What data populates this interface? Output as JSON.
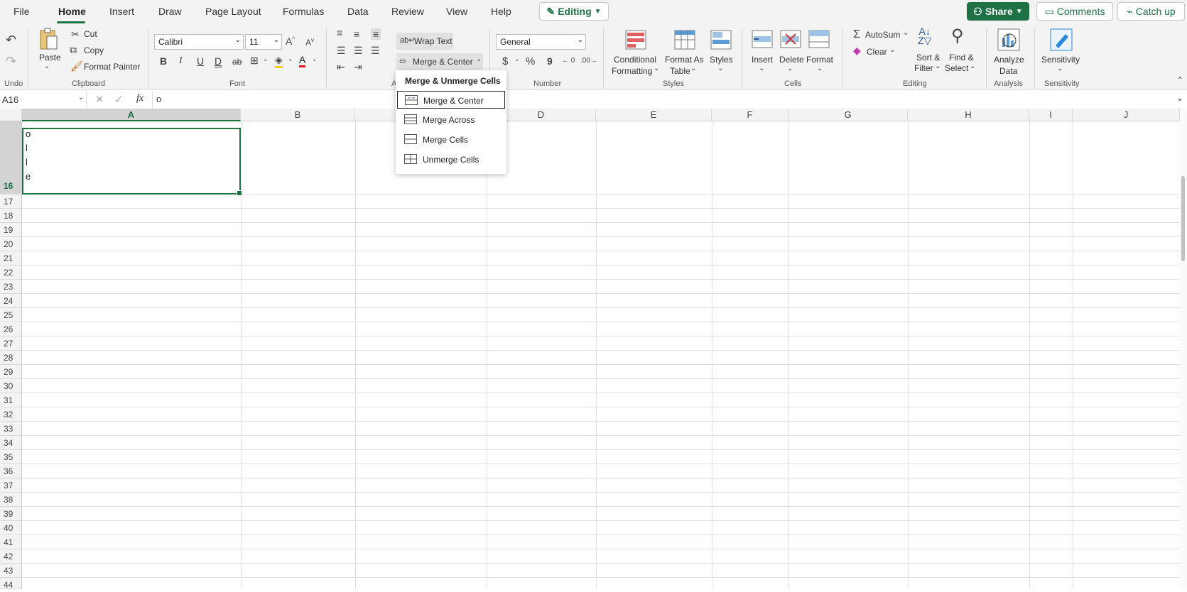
{
  "tabs": [
    "File",
    "Home",
    "Insert",
    "Draw",
    "Page Layout",
    "Formulas",
    "Data",
    "Review",
    "View",
    "Help"
  ],
  "editing_label": "Editing",
  "share_label": "Share",
  "comments_label": "Comments",
  "catchup_label": "Catch up",
  "ribbon": {
    "undo_group": "Undo",
    "clipboard": {
      "paste": "Paste",
      "cut": "Cut",
      "copy": "Copy",
      "format_painter": "Format Painter",
      "group": "Clipboard"
    },
    "font": {
      "name": "Calibri",
      "size": "11",
      "group": "Font",
      "bold": "B",
      "italic": "I",
      "underline": "U",
      "double_underline": "D",
      "strike": "ab"
    },
    "alignment": {
      "wrap_text": "Wrap Text",
      "merge_center": "Merge & Center",
      "group_fragment": "A"
    },
    "number": {
      "format": "General",
      "currency": "$",
      "percent": "%",
      "comma": "9",
      "group": "Number"
    },
    "styles": {
      "conditional": "Conditional",
      "conditional2": "Formatting",
      "format_as": "Format As",
      "format_as2": "Table",
      "styles": "Styles",
      "group": "Styles"
    },
    "cells": {
      "insert": "Insert",
      "delete": "Delete",
      "format": "Format",
      "group": "Cells"
    },
    "editing": {
      "autosum": "AutoSum",
      "clear": "Clear",
      "sort": "Sort &",
      "sort2": "Filter",
      "find": "Find &",
      "find2": "Select",
      "group": "Editing"
    },
    "analysis": {
      "analyze": "Analyze",
      "analyze2": "Data",
      "group": "Analysis"
    },
    "sensitivity": {
      "label": "Sensitivity",
      "group": "Sensitivity"
    }
  },
  "formula_bar": {
    "name_box": "A16",
    "fx": "fx",
    "content": "o"
  },
  "columns": [
    "A",
    "B",
    "C",
    "D",
    "E",
    "F",
    "G",
    "H",
    "I",
    "J"
  ],
  "selected_column": "A",
  "rows": [
    "16",
    "17",
    "18",
    "19",
    "20",
    "21",
    "22",
    "23",
    "24",
    "25",
    "26",
    "27",
    "28",
    "29",
    "30",
    "31",
    "32",
    "33",
    "34",
    "35",
    "36",
    "37",
    "38",
    "39",
    "40",
    "41",
    "42",
    "43",
    "44"
  ],
  "cell_a16_lines": [
    "o",
    "l",
    "l",
    "e"
  ],
  "merge_menu": {
    "title": "Merge & Unmerge Cells",
    "items": [
      "Merge & Center",
      "Merge Across",
      "Merge Cells",
      "Unmerge Cells"
    ]
  },
  "colors": {
    "accent": "#217346",
    "share": "#1e7145"
  }
}
